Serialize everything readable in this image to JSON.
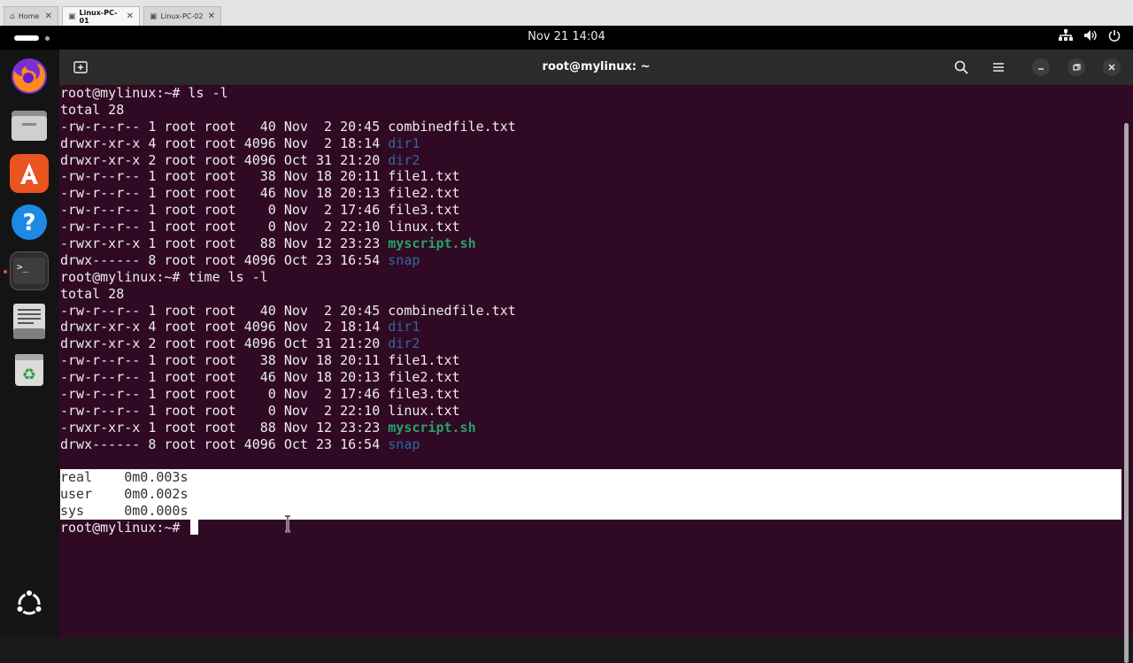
{
  "host_tabs": [
    {
      "label": "Home",
      "icon": "home-icon",
      "active": false
    },
    {
      "label": "Linux-PC-01",
      "icon": "vm-icon",
      "active": true
    },
    {
      "label": "Linux-PC-02",
      "icon": "vm-icon",
      "active": false
    }
  ],
  "topbar": {
    "clock": "Nov 21  14:04",
    "tray_icons": [
      "network-icon",
      "volume-icon",
      "power-icon"
    ]
  },
  "dock": {
    "items": [
      {
        "name": "firefox",
        "icon": "firefox-icon"
      },
      {
        "name": "files",
        "icon": "files-icon"
      },
      {
        "name": "app-center",
        "icon": "app-center-icon"
      },
      {
        "name": "help",
        "icon": "help-icon"
      },
      {
        "name": "terminal",
        "icon": "terminal-icon",
        "running": true
      },
      {
        "name": "text-editor",
        "icon": "text-editor-icon"
      },
      {
        "name": "trash",
        "icon": "trash-icon"
      }
    ],
    "bottom_icon": "ubuntu-icon"
  },
  "window": {
    "title": "root@mylinux: ~",
    "buttons": [
      "new-tab-icon",
      "search-icon",
      "menu-icon",
      "minimize-icon",
      "maximize-icon",
      "close-icon"
    ]
  },
  "terminal": {
    "prompt": "root@mylinux:~# ",
    "lines": [
      {
        "type": "text",
        "text": "root@mylinux:~# ls -l"
      },
      {
        "type": "text",
        "text": "total 28"
      },
      {
        "type": "entry",
        "meta": "-rw-r--r-- 1 root root   40 Nov  2 20:45 ",
        "name": "combinedfile.txt",
        "kind": "file"
      },
      {
        "type": "entry",
        "meta": "drwxr-xr-x 4 root root 4096 Nov  2 18:14 ",
        "name": "dir1",
        "kind": "dir"
      },
      {
        "type": "entry",
        "meta": "drwxr-xr-x 2 root root 4096 Oct 31 21:20 ",
        "name": "dir2",
        "kind": "dir"
      },
      {
        "type": "entry",
        "meta": "-rw-r--r-- 1 root root   38 Nov 18 20:11 ",
        "name": "file1.txt",
        "kind": "file"
      },
      {
        "type": "entry",
        "meta": "-rw-r--r-- 1 root root   46 Nov 18 20:13 ",
        "name": "file2.txt",
        "kind": "file"
      },
      {
        "type": "entry",
        "meta": "-rw-r--r-- 1 root root    0 Nov  2 17:46 ",
        "name": "file3.txt",
        "kind": "file"
      },
      {
        "type": "entry",
        "meta": "-rw-r--r-- 1 root root    0 Nov  2 22:10 ",
        "name": "linux.txt",
        "kind": "file"
      },
      {
        "type": "entry",
        "meta": "-rwxr-xr-x 1 root root   88 Nov 12 23:23 ",
        "name": "myscript.sh",
        "kind": "exe"
      },
      {
        "type": "entry",
        "meta": "drwx------ 8 root root 4096 Oct 23 16:54 ",
        "name": "snap",
        "kind": "dir"
      },
      {
        "type": "text",
        "text": "root@mylinux:~# time ls -l"
      },
      {
        "type": "text",
        "text": "total 28"
      },
      {
        "type": "entry",
        "meta": "-rw-r--r-- 1 root root   40 Nov  2 20:45 ",
        "name": "combinedfile.txt",
        "kind": "file"
      },
      {
        "type": "entry",
        "meta": "drwxr-xr-x 4 root root 4096 Nov  2 18:14 ",
        "name": "dir1",
        "kind": "dir"
      },
      {
        "type": "entry",
        "meta": "drwxr-xr-x 2 root root 4096 Oct 31 21:20 ",
        "name": "dir2",
        "kind": "dir"
      },
      {
        "type": "entry",
        "meta": "-rw-r--r-- 1 root root   38 Nov 18 20:11 ",
        "name": "file1.txt",
        "kind": "file"
      },
      {
        "type": "entry",
        "meta": "-rw-r--r-- 1 root root   46 Nov 18 20:13 ",
        "name": "file2.txt",
        "kind": "file"
      },
      {
        "type": "entry",
        "meta": "-rw-r--r-- 1 root root    0 Nov  2 17:46 ",
        "name": "file3.txt",
        "kind": "file"
      },
      {
        "type": "entry",
        "meta": "-rw-r--r-- 1 root root    0 Nov  2 22:10 ",
        "name": "linux.txt",
        "kind": "file"
      },
      {
        "type": "entry",
        "meta": "-rwxr-xr-x 1 root root   88 Nov 12 23:23 ",
        "name": "myscript.sh",
        "kind": "exe"
      },
      {
        "type": "entry",
        "meta": "drwx------ 8 root root 4096 Oct 23 16:54 ",
        "name": "snap",
        "kind": "dir"
      },
      {
        "type": "blank",
        "text": ""
      },
      {
        "type": "selected",
        "text": "real\t0m0.003s"
      },
      {
        "type": "selected",
        "text": "user\t0m0.002s"
      },
      {
        "type": "selected",
        "text": "sys\t0m0.000s"
      }
    ]
  },
  "colors": {
    "terminal_bg": "#300a24",
    "dir": "#3465a4",
    "executable": "#26a269",
    "accent": "#e95420"
  }
}
